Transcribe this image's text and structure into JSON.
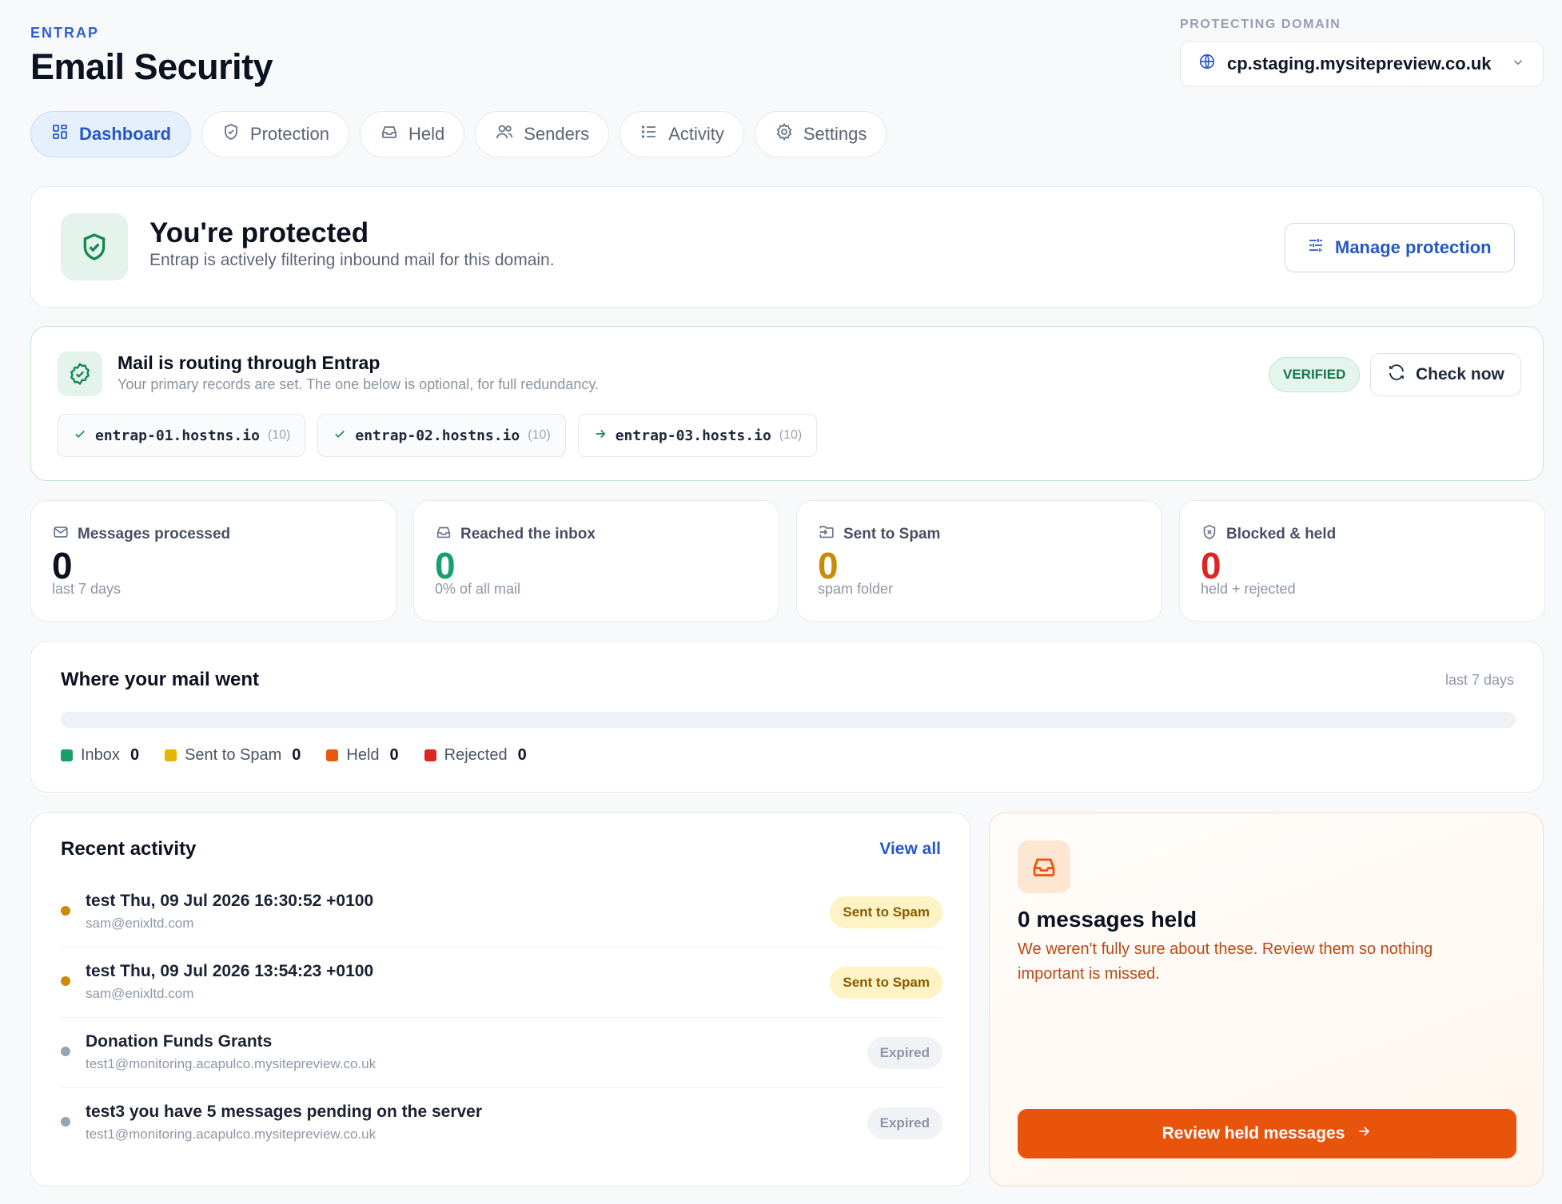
{
  "header": {
    "brand": "ENTRAP",
    "title": "Email Security",
    "domain_label": "PROTECTING DOMAIN",
    "domain_value": "cp.staging.mysitepreview.co.uk"
  },
  "tabs": [
    {
      "label": "Dashboard",
      "icon": "grid-icon",
      "active": true
    },
    {
      "label": "Protection",
      "icon": "shield-icon"
    },
    {
      "label": "Held",
      "icon": "inbox-icon"
    },
    {
      "label": "Senders",
      "icon": "users-icon"
    },
    {
      "label": "Activity",
      "icon": "list-icon"
    },
    {
      "label": "Settings",
      "icon": "gear-icon"
    }
  ],
  "protection": {
    "title": "You're protected",
    "subtitle": "Entrap is actively filtering inbound mail for this domain.",
    "manage_label": "Manage protection"
  },
  "routing": {
    "title": "Mail is routing through Entrap",
    "subtitle": "Your primary records are set. The one below is optional, for full redundancy.",
    "status": "VERIFIED",
    "check_label": "Check now",
    "hosts": [
      {
        "name": "entrap-01.hostns.io",
        "priority": "(10)",
        "state": "ok"
      },
      {
        "name": "entrap-02.hostns.io",
        "priority": "(10)",
        "state": "ok"
      },
      {
        "name": "entrap-03.hosts.io",
        "priority": "(10)",
        "state": "optional"
      }
    ]
  },
  "stats": [
    {
      "label": "Messages processed",
      "value": "0",
      "note": "last 7 days",
      "color": "#0b1220",
      "icon": "mail-icon"
    },
    {
      "label": "Reached the inbox",
      "value": "0",
      "note": "0% of all mail",
      "color": "#16a06a",
      "icon": "inbox-icon"
    },
    {
      "label": "Sent to Spam",
      "value": "0",
      "note": "spam folder",
      "color": "#c98a04",
      "icon": "spam-folder-icon"
    },
    {
      "label": "Blocked & held",
      "value": "0",
      "note": "held + rejected",
      "color": "#dc2626",
      "icon": "blocked-shield-icon"
    }
  ],
  "distribution": {
    "title": "Where your mail went",
    "range": "last 7 days",
    "items": [
      {
        "label": "Inbox",
        "value": "0",
        "color": "#16a06a"
      },
      {
        "label": "Sent to Spam",
        "value": "0",
        "color": "#eab308"
      },
      {
        "label": "Held",
        "value": "0",
        "color": "#ea580c"
      },
      {
        "label": "Rejected",
        "value": "0",
        "color": "#dc2626"
      }
    ]
  },
  "recent": {
    "title": "Recent activity",
    "view_all": "View all",
    "items": [
      {
        "subject": "test Thu, 09 Jul 2026 16:30:52 +0100",
        "from": "sam@enixltd.com",
        "status": "Sent to Spam",
        "kind": "spam"
      },
      {
        "subject": "test Thu, 09 Jul 2026 13:54:23 +0100",
        "from": "sam@enixltd.com",
        "status": "Sent to Spam",
        "kind": "spam"
      },
      {
        "subject": "Donation Funds Grants",
        "from": "test1@monitoring.acapulco.mysitepreview.co.uk",
        "status": "Expired",
        "kind": "expired"
      },
      {
        "subject": "test3 you have 5 messages pending on the server",
        "from": "test1@monitoring.acapulco.mysitepreview.co.uk",
        "status": "Expired",
        "kind": "expired"
      }
    ]
  },
  "held": {
    "title": "0 messages held",
    "subtitle": "We weren't fully sure about these. Review them so nothing important is missed.",
    "button": "Review held messages"
  }
}
